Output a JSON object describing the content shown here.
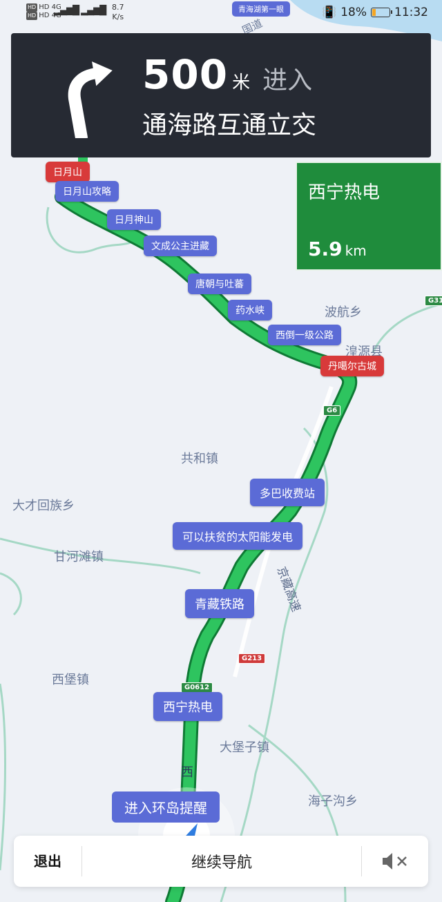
{
  "status": {
    "net_top": "HD 4G",
    "net_bottom": "HD 4G",
    "speed_value": "8.7",
    "speed_unit": "K/s",
    "battery": "18%",
    "time": "11:32"
  },
  "top_label": "青海湖第一眼",
  "nav": {
    "distance": "500",
    "unit": "米",
    "action": "进入",
    "road": "通海路互通立交"
  },
  "destination": {
    "name": "西宁热电",
    "distance": "5.9",
    "unit": "km"
  },
  "pois": [
    {
      "label": "日月山"
    },
    {
      "label": "日月山攻略"
    },
    {
      "label": "日月神山"
    },
    {
      "label": "文成公主进藏"
    },
    {
      "label": "唐朝与吐蕃"
    },
    {
      "label": "药水峡"
    },
    {
      "label": "西倒一级公路"
    },
    {
      "label": "丹噶尔古城"
    },
    {
      "label": "多巴收费站"
    },
    {
      "label": "可以扶贫的太阳能发电"
    },
    {
      "label": "青藏铁路"
    },
    {
      "label": "西宁热电"
    }
  ],
  "towns": [
    "波航乡",
    "湟源县",
    "共和镇",
    "大才回族乡",
    "甘河滩镇",
    "西堡镇",
    "大堡子镇",
    "海子沟乡"
  ],
  "road_labels": [
    "国道",
    "京藏高速",
    "西"
  ],
  "shields": {
    "g6": "G6",
    "g31": "G31",
    "g213": "G213",
    "g0612": "G0612"
  },
  "roundabout_hint": "进入环岛提醒",
  "bottom": {
    "exit": "退出",
    "continue": "继续导航"
  },
  "colors": {
    "route": "#1faa4c",
    "poi": "#5b6bd6",
    "banner": "#262a33",
    "dest": "#1f8c3c"
  }
}
